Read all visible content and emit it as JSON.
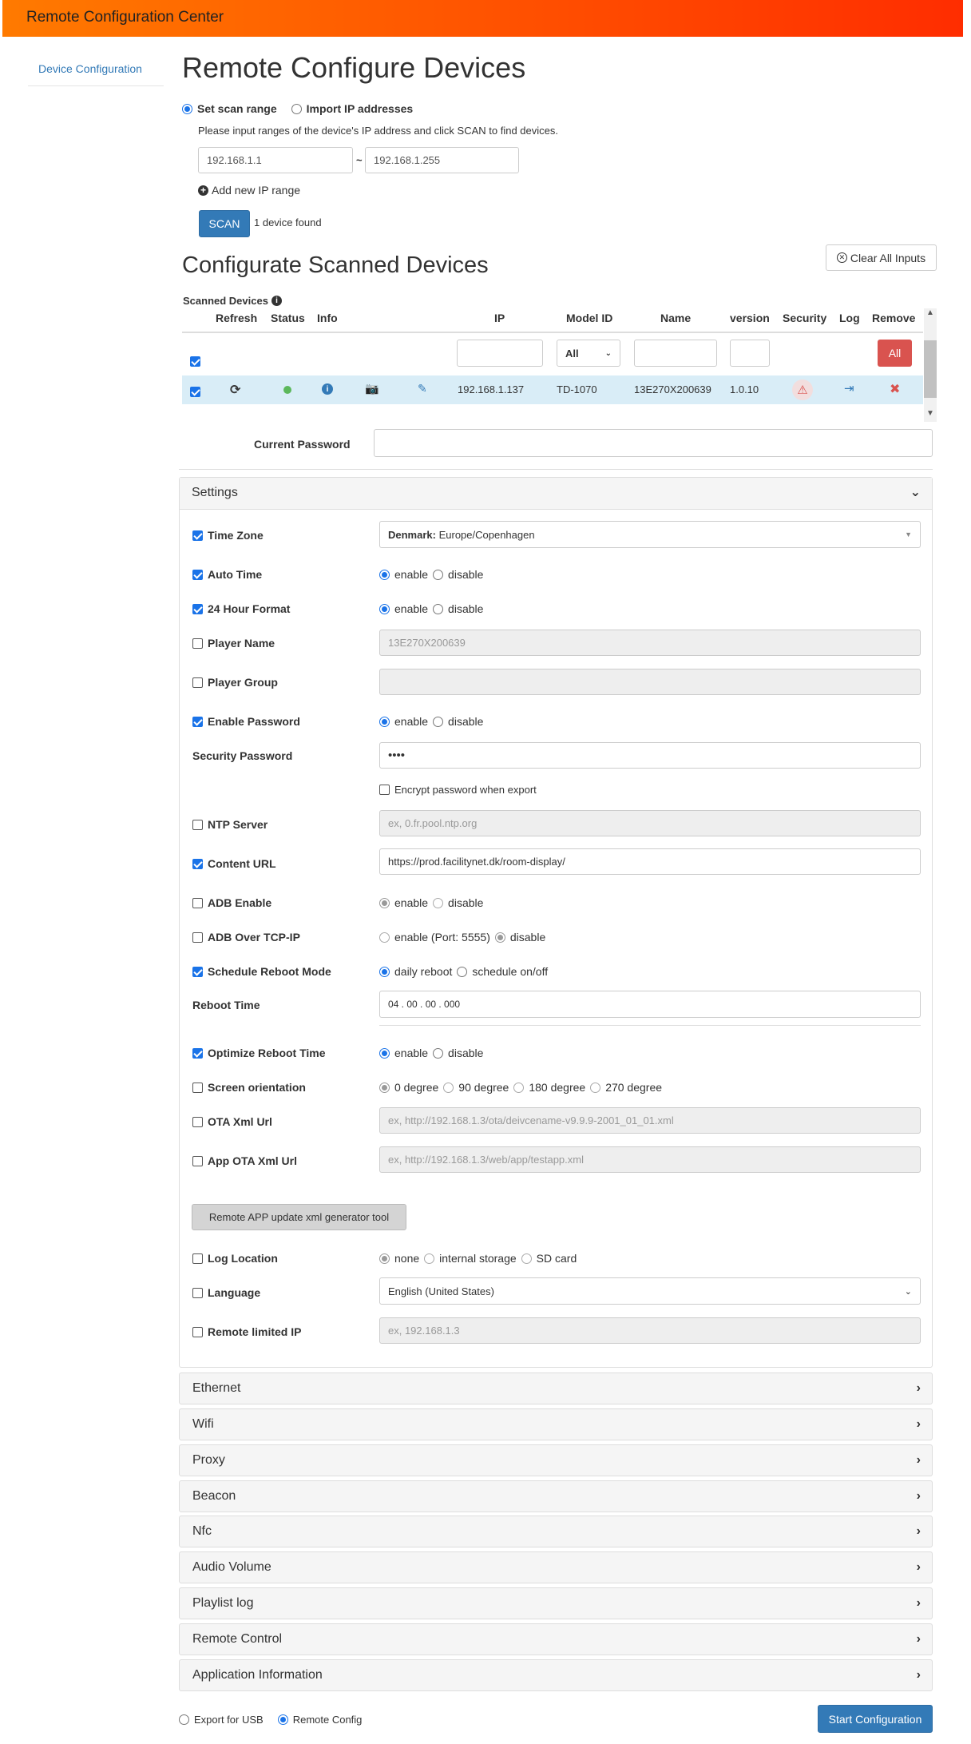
{
  "header": {
    "title": "Remote Configuration Center"
  },
  "sidebar": {
    "items": [
      {
        "label": "Device Configuration"
      }
    ]
  },
  "scan": {
    "title": "Remote Configure Devices",
    "mode_scan": "Set scan range",
    "mode_import": "Import IP addresses",
    "instructions": "Please input ranges of the device's IP address and click SCAN to find devices.",
    "ip_from": "192.168.1.1",
    "tilde": "~",
    "ip_to": "192.168.1.255",
    "add_range": "Add new IP range",
    "scan_button": "SCAN",
    "found": "1 device found"
  },
  "configurate": {
    "title": "Configurate Scanned Devices",
    "clear_all": "Clear All Inputs",
    "scanned_devices": "Scanned Devices"
  },
  "table": {
    "headers": {
      "refresh": "Refresh",
      "status": "Status",
      "info": "Info",
      "ip": "IP",
      "model": "Model ID",
      "name": "Name",
      "version": "version",
      "security": "Security",
      "log": "Log",
      "remove": "Remove"
    },
    "filter_model": "All",
    "remove_all": "All",
    "row": {
      "ip": "192.168.1.137",
      "model": "TD-1070",
      "name": "13E270X200639",
      "version": "1.0.10"
    },
    "status_color": "#5cb85c"
  },
  "current_password": {
    "label": "Current Password"
  },
  "settings": {
    "title": "Settings",
    "time_zone": {
      "label": "Time Zone",
      "country": "Denmark:",
      "zone": "Europe/Copenhagen"
    },
    "auto_time": {
      "label": "Auto Time",
      "opt1": "enable",
      "opt2": "disable"
    },
    "hour24": {
      "label": "24 Hour Format",
      "opt1": "enable",
      "opt2": "disable"
    },
    "player_name": {
      "label": "Player Name",
      "value": "13E270X200639"
    },
    "player_group": {
      "label": "Player Group"
    },
    "enable_password": {
      "label": "Enable Password",
      "opt1": "enable",
      "opt2": "disable"
    },
    "security_password": {
      "label": "Security Password",
      "value": "••••",
      "encrypt": "Encrypt password when export"
    },
    "ntp": {
      "label": "NTP Server",
      "placeholder": "ex, 0.fr.pool.ntp.org"
    },
    "content_url": {
      "label": "Content URL",
      "value": "https://prod.facilitynet.dk/room-display/"
    },
    "adb": {
      "label": "ADB Enable",
      "opt1": "enable",
      "opt2": "disable"
    },
    "adb_tcp": {
      "label": "ADB Over TCP-IP",
      "opt1": "enable (Port: 5555)",
      "opt2": "disable"
    },
    "reboot_mode": {
      "label": "Schedule Reboot Mode",
      "opt1": "daily reboot",
      "opt2": "schedule on/off"
    },
    "reboot_time": {
      "label": "Reboot Time",
      "value": "04 . 00 . 00 . 000"
    },
    "optimize_reboot": {
      "label": "Optimize Reboot Time",
      "opt1": "enable",
      "opt2": "disable"
    },
    "orientation": {
      "label": "Screen orientation",
      "opt1": "0 degree",
      "opt2": "90 degree",
      "opt3": "180 degree",
      "opt4": "270 degree"
    },
    "ota": {
      "label": "OTA Xml Url",
      "placeholder": "ex, http://192.168.1.3/ota/deivcename-v9.9.9-2001_01_01.xml"
    },
    "app_ota": {
      "label": "App OTA Xml Url",
      "placeholder": "ex, http://192.168.1.3/web/app/testapp.xml"
    },
    "generator_button": "Remote APP update xml generator tool",
    "log_location": {
      "label": "Log Location",
      "opt1": "none",
      "opt2": "internal storage",
      "opt3": "SD card"
    },
    "language": {
      "label": "Language",
      "value": "English (United States)"
    },
    "remote_ip": {
      "label": "Remote limited IP",
      "placeholder": "ex, 192.168.1.3"
    }
  },
  "sections": [
    "Ethernet",
    "Wifi",
    "Proxy",
    "Beacon",
    "Nfc",
    "Audio Volume",
    "Playlist log",
    "Remote Control",
    "Application Information"
  ],
  "footer": {
    "export_usb": "Export for USB",
    "remote_config": "Remote Config",
    "start": "Start Configuration"
  }
}
